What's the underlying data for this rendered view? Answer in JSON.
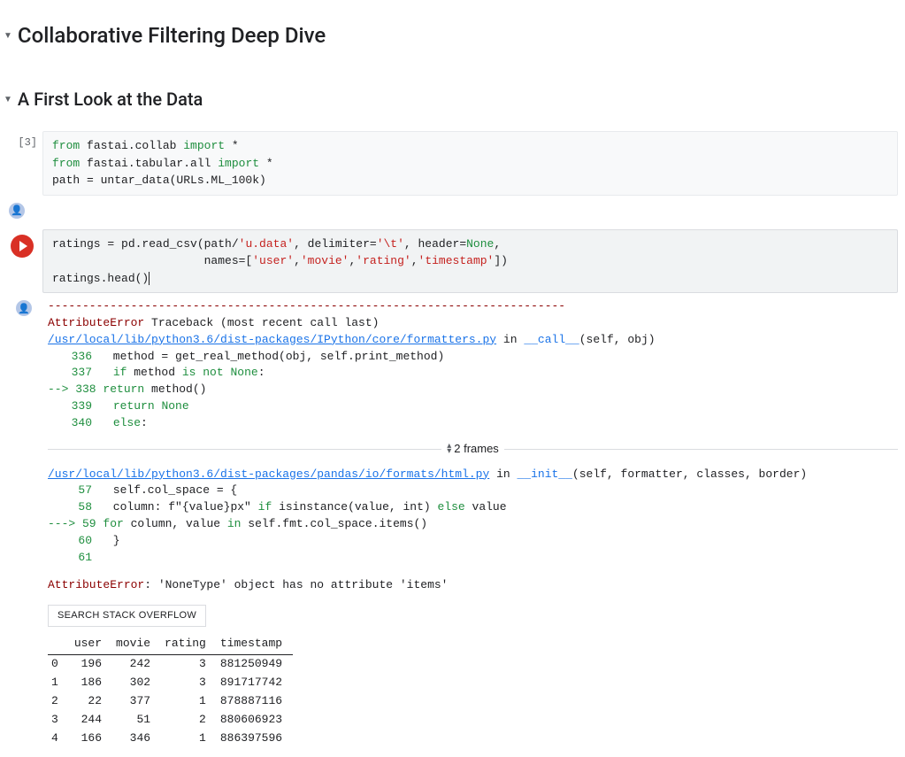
{
  "headings": {
    "h1": "Collaborative Filtering Deep Dive",
    "h2": "A First Look at the Data"
  },
  "cell1": {
    "exec_label": "[3]",
    "code_line1_a": "from",
    "code_line1_b": " fastai.collab ",
    "code_line1_c": "import",
    "code_line1_d": " *",
    "code_line2_a": "from",
    "code_line2_b": " fastai.tabular.all ",
    "code_line2_c": "import",
    "code_line2_d": " *",
    "code_line3": "path = untar_data(URLs.ML_100k)"
  },
  "cell2": {
    "code_line1_a": "ratings = pd.read_csv(path/",
    "code_line1_b": "'u.data'",
    "code_line1_c": ", delimiter=",
    "code_line1_d": "'\\t'",
    "code_line1_e": ", header=",
    "code_line1_f": "None",
    "code_line1_g": ",",
    "code_line2_a": "                      names=[",
    "code_line2_b": "'user'",
    "code_line2_c": ",",
    "code_line2_d": "'movie'",
    "code_line2_e": ",",
    "code_line2_f": "'rating'",
    "code_line2_g": ",",
    "code_line2_h": "'timestamp'",
    "code_line2_i": "])",
    "code_line3": "ratings.head()"
  },
  "traceback": {
    "divider": "---------------------------------------------------------------------------",
    "error_name": "AttributeError",
    "header_tail": "                          Traceback (most recent call last)",
    "file1_link": "/usr/local/lib/python3.6/dist-packages/IPython/core/formatters.py",
    "file1_tail_a": " in ",
    "file1_call": "__call__",
    "file1_tail_b": "(self, obj)",
    "l336_num": "336",
    "l336_txt": "            method = get_real_method(obj, self.print_method)",
    "l337_num": "337",
    "l337_a": "            ",
    "l337_b": "if",
    "l337_c": " method ",
    "l337_d": "is not",
    "l337_e": " ",
    "l337_f": "None",
    "l337_g": ":",
    "l338_arrow": "--> 338",
    "l338_a": "                ",
    "l338_b": "return",
    "l338_c": " method()",
    "l339_num": "339",
    "l339_a": "            ",
    "l339_b": "return",
    "l339_c": " ",
    "l339_d": "None",
    "l340_num": "340",
    "l340_a": "        ",
    "l340_b": "else",
    "l340_c": ":",
    "frames_label": "2 frames",
    "file2_link": "/usr/local/lib/python3.6/dist-packages/pandas/io/formats/html.py",
    "file2_tail_a": " in ",
    "file2_call": "__init__",
    "file2_tail_b": "(self, formatter, classes, border)",
    "l57_num": "57",
    "l57_txt": "        self.col_space = {",
    "l58_num": "58",
    "l58_a": "            column: f\"",
    "l58_b": "{value}",
    "l58_c": "px\" ",
    "l58_d": "if",
    "l58_e": " isinstance(value, int) ",
    "l58_f": "else",
    "l58_g": " value",
    "l59_arrow": "---> 59",
    "l59_a": "            ",
    "l59_b": "for",
    "l59_c": " column, value ",
    "l59_d": "in",
    "l59_e": " self.fmt.col_space.items()",
    "l60_num": "60",
    "l60_txt": "        }",
    "l61_num": "61",
    "l61_txt": "",
    "final_err_name": "AttributeError",
    "final_err_msg": ": 'NoneType' object has no attribute 'items'",
    "search_button": "SEARCH STACK OVERFLOW"
  },
  "dataframe": {
    "columns": [
      "user",
      "movie",
      "rating",
      "timestamp"
    ],
    "rows": [
      {
        "idx": "0",
        "user": "196",
        "movie": "242",
        "rating": "3",
        "timestamp": "881250949"
      },
      {
        "idx": "1",
        "user": "186",
        "movie": "302",
        "rating": "3",
        "timestamp": "891717742"
      },
      {
        "idx": "2",
        "user": "22",
        "movie": "377",
        "rating": "1",
        "timestamp": "878887116"
      },
      {
        "idx": "3",
        "user": "244",
        "movie": "51",
        "rating": "2",
        "timestamp": "880606923"
      },
      {
        "idx": "4",
        "user": "166",
        "movie": "346",
        "rating": "1",
        "timestamp": "886397596"
      }
    ]
  }
}
